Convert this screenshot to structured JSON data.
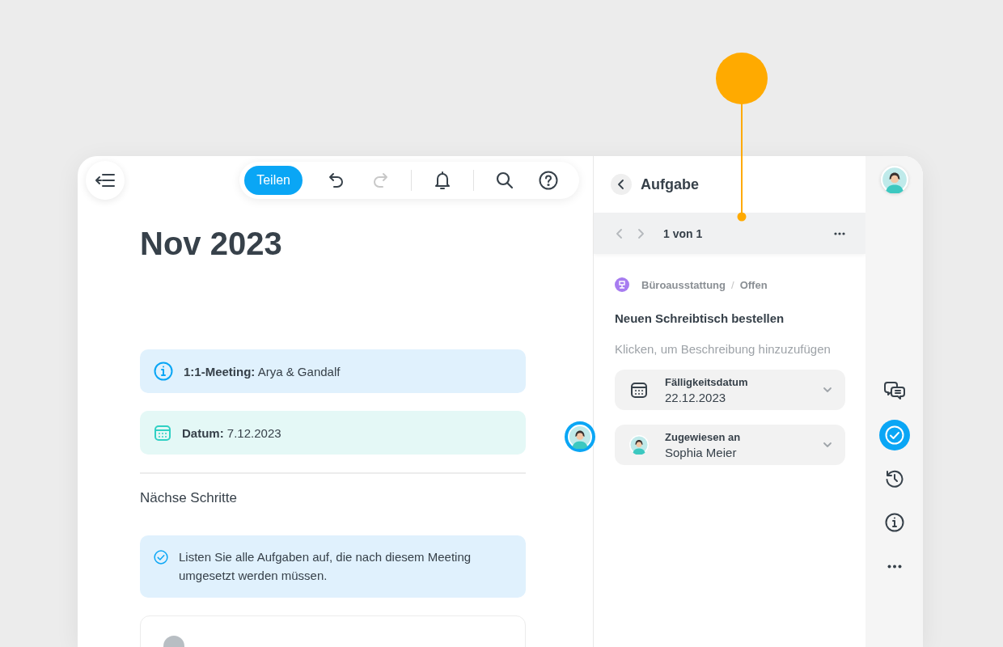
{
  "toolbar": {
    "share_button": "Teilen",
    "button_groups": [
      [
        {
          "kind": "undo",
          "disabled": false
        },
        {
          "kind": "redo",
          "disabled": true
        }
      ],
      [
        {
          "kind": "bell",
          "disabled": false
        }
      ],
      [
        {
          "kind": "search",
          "disabled": false
        },
        {
          "kind": "help",
          "disabled": false
        }
      ]
    ]
  },
  "document": {
    "title": "Nov 2023",
    "callouts": [
      {
        "kind": "info",
        "text": "**1:1-Meeting:** Arya & Gandalf"
      },
      {
        "kind": "date",
        "text": "**Datum:** 7.12.2023"
      }
    ],
    "section_heading": "Nächse Schritte",
    "task_callout": {
      "kind": "task",
      "text": "Listen Sie alle Aufgaben auf, die nach diesem Meeting umgesetzt werden müssen."
    }
  },
  "task_panel": {
    "title": "Aufgabe",
    "pager": "1 von 1",
    "breadcrumb": [
      "Büroausstattung",
      "Offen"
    ],
    "breadcrumb_separator": "/",
    "task_title": "Neuen Schreibtisch bestellen",
    "description_placeholder": "Klicken, um Beschreibung hinzuzufügen",
    "fields": [
      {
        "kind": "date",
        "label": "Fälligkeitsdatum",
        "value": "22.12.2023"
      },
      {
        "kind": "assignee",
        "label": "Zugewiesen an",
        "value": "Sophia Meier"
      }
    ]
  },
  "rail": {
    "items": [
      {
        "kind": "comments",
        "selected": false
      },
      {
        "kind": "tasks",
        "selected": true
      },
      {
        "kind": "history",
        "selected": false
      },
      {
        "kind": "info",
        "selected": false
      },
      {
        "kind": "more",
        "selected": false
      }
    ]
  }
}
